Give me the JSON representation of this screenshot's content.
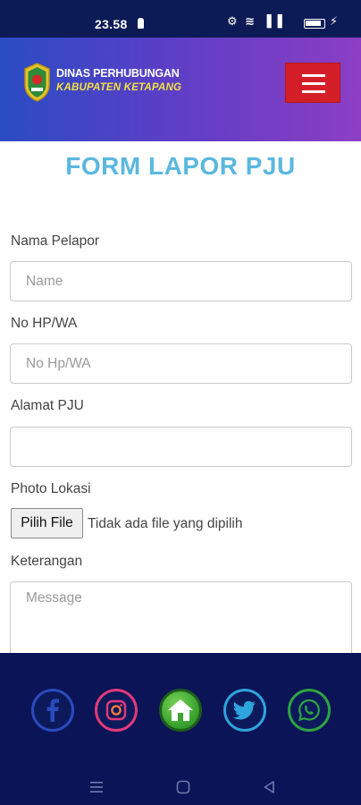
{
  "status_bar": {
    "time": "23.58",
    "icons": "⚙ ≋ ▐▐"
  },
  "header": {
    "brand_name": "DINAS PERHUBUNGAN",
    "brand_sub": "KABUPATEN KETAPANG"
  },
  "form": {
    "title": "FORM LAPOR PJU",
    "nama_label": "Nama Pelapor",
    "nama_placeholder": "Name",
    "hp_label": "No HP/WA",
    "hp_placeholder": "No Hp/WA",
    "alamat_label": "Alamat PJU",
    "alamat_placeholder": "",
    "photo_label": "Photo Lokasi",
    "file_button": "Pilih File",
    "file_status": "Tidak ada file yang dipilih",
    "keterangan_label": "Keterangan",
    "keterangan_placeholder": "Message"
  },
  "social": [
    "facebook-icon",
    "instagram-icon",
    "home-icon",
    "twitter-icon",
    "whatsapp-icon"
  ],
  "colors": {
    "title": "#5bb8df",
    "menu_button": "#d41f28",
    "footer": "#0a1457",
    "home": "#3aa52f",
    "brand_sub": "#f3e040"
  }
}
